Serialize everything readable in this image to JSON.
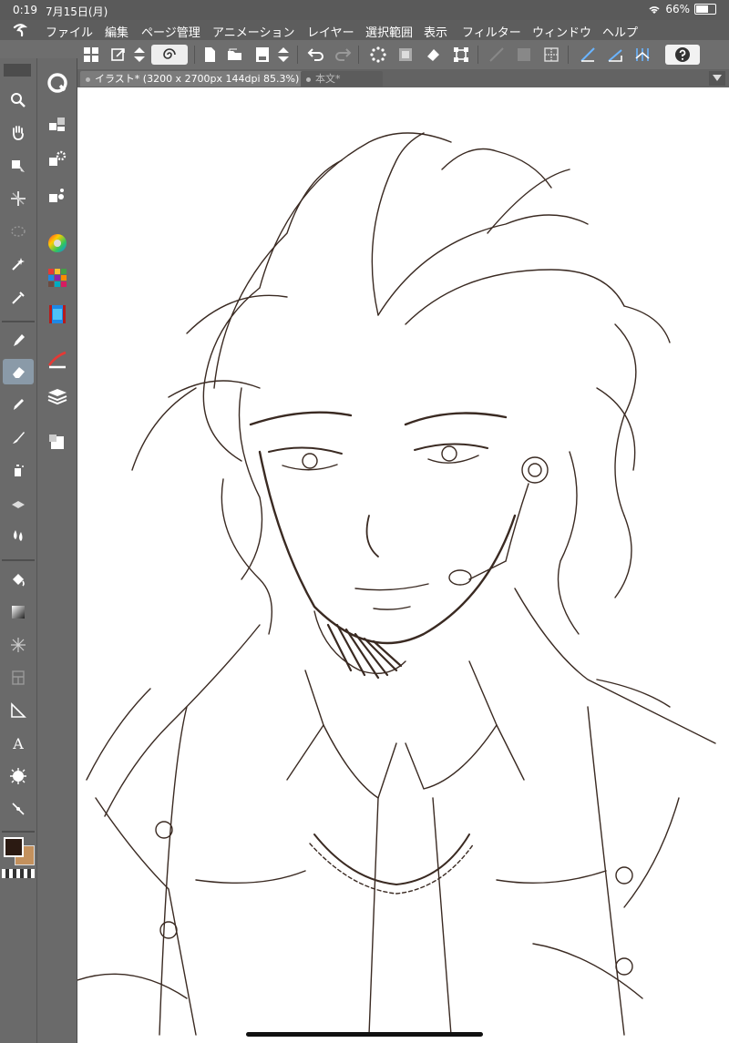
{
  "status": {
    "time": "0:19",
    "date": "7月15日(月)",
    "battery": "66%",
    "battery_level": 0.66
  },
  "menu": [
    "ファイル",
    "編集",
    "ページ管理",
    "アニメーション",
    "レイヤー",
    "選択範囲",
    "表示",
    "フィルター",
    "ウィンドウ",
    "ヘルプ"
  ],
  "tabs": [
    {
      "label": "イラスト* (3200 x 2700px 144dpi 85.3%)"
    },
    {
      "label": "本文*"
    }
  ],
  "colors": {
    "main": "#2b1a12",
    "sub": "#c4915d",
    "selected_tool": "#8a9aa8"
  },
  "tools": [
    "zoom-icon",
    "hand-icon",
    "operation-icon",
    "move-layer-icon",
    "selection-icon",
    "auto-select-icon",
    "eyedropper-icon",
    "pen-icon",
    "eraser-icon",
    "pencil-icon",
    "brush-icon",
    "airbrush-icon",
    "decoration-icon",
    "blend-icon",
    "fill-icon",
    "gradation-icon",
    "figure-icon",
    "frame-border-icon",
    "ruler-icon",
    "text-icon",
    "balloon-icon",
    "correct-line-icon"
  ],
  "subtools": [
    "quick-access-icon",
    "sub-tool-icon",
    "tool-property-icon",
    "brush-size-icon",
    "color-circle-icon",
    "color-set-icon",
    "animation-timeline-icon",
    "color-history-icon",
    "layer-icon",
    "material-icon"
  ]
}
